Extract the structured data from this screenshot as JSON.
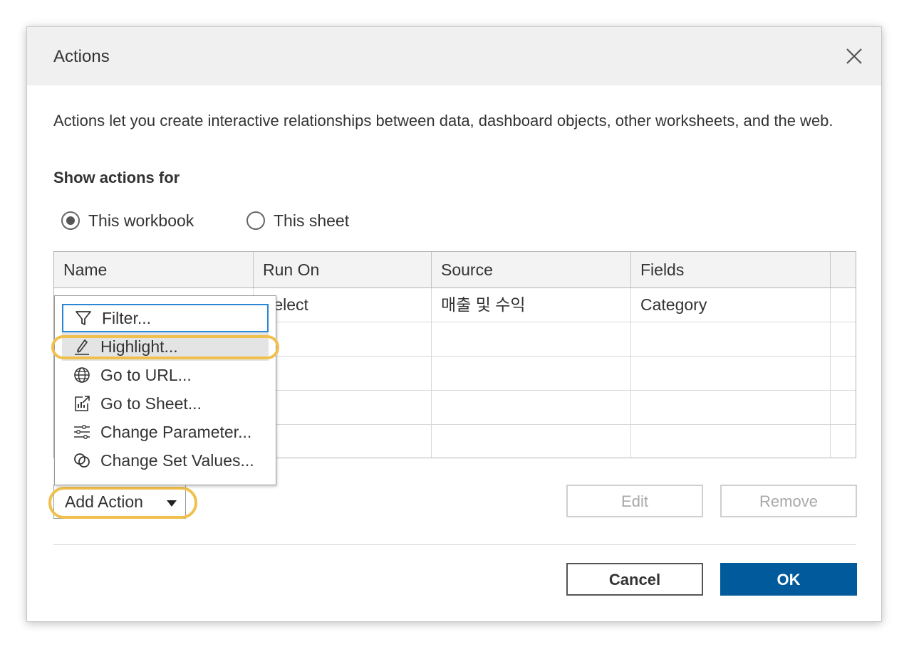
{
  "dialog": {
    "title": "Actions",
    "description": "Actions let you create interactive relationships between data, dashboard objects, other worksheets, and the web.",
    "section_label": "Show actions for",
    "radios": [
      {
        "label": "This workbook",
        "checked": true
      },
      {
        "label": "This sheet",
        "checked": false
      }
    ]
  },
  "table": {
    "columns": [
      "Name",
      "Run On",
      "Source",
      "Fields"
    ],
    "rows": [
      {
        "name": "",
        "run_on": "Select",
        "source": "매출 및 수익",
        "fields": "Category"
      },
      {
        "name": "",
        "run_on": "",
        "source": "",
        "fields": ""
      },
      {
        "name": "",
        "run_on": "",
        "source": "",
        "fields": ""
      },
      {
        "name": "",
        "run_on": "",
        "source": "",
        "fields": ""
      },
      {
        "name": "",
        "run_on": "",
        "source": "",
        "fields": ""
      }
    ]
  },
  "menu": {
    "items": [
      {
        "label": "Filter...",
        "icon": "filter-icon"
      },
      {
        "label": "Highlight...",
        "icon": "highlighter-icon"
      },
      {
        "label": "Go to URL...",
        "icon": "globe-icon"
      },
      {
        "label": "Go to Sheet...",
        "icon": "go-to-sheet-icon"
      },
      {
        "label": "Change Parameter...",
        "icon": "sliders-icon"
      },
      {
        "label": "Change Set Values...",
        "icon": "set-values-icon"
      }
    ]
  },
  "buttons": {
    "add_action": "Add Action",
    "edit": "Edit",
    "remove": "Remove",
    "cancel": "Cancel",
    "ok": "OK"
  },
  "colors": {
    "primary": "#005a9b",
    "highlight_annotation": "#f0c04d",
    "focus_ring": "#2b86d6",
    "titlebar": "#f0f0f0"
  }
}
